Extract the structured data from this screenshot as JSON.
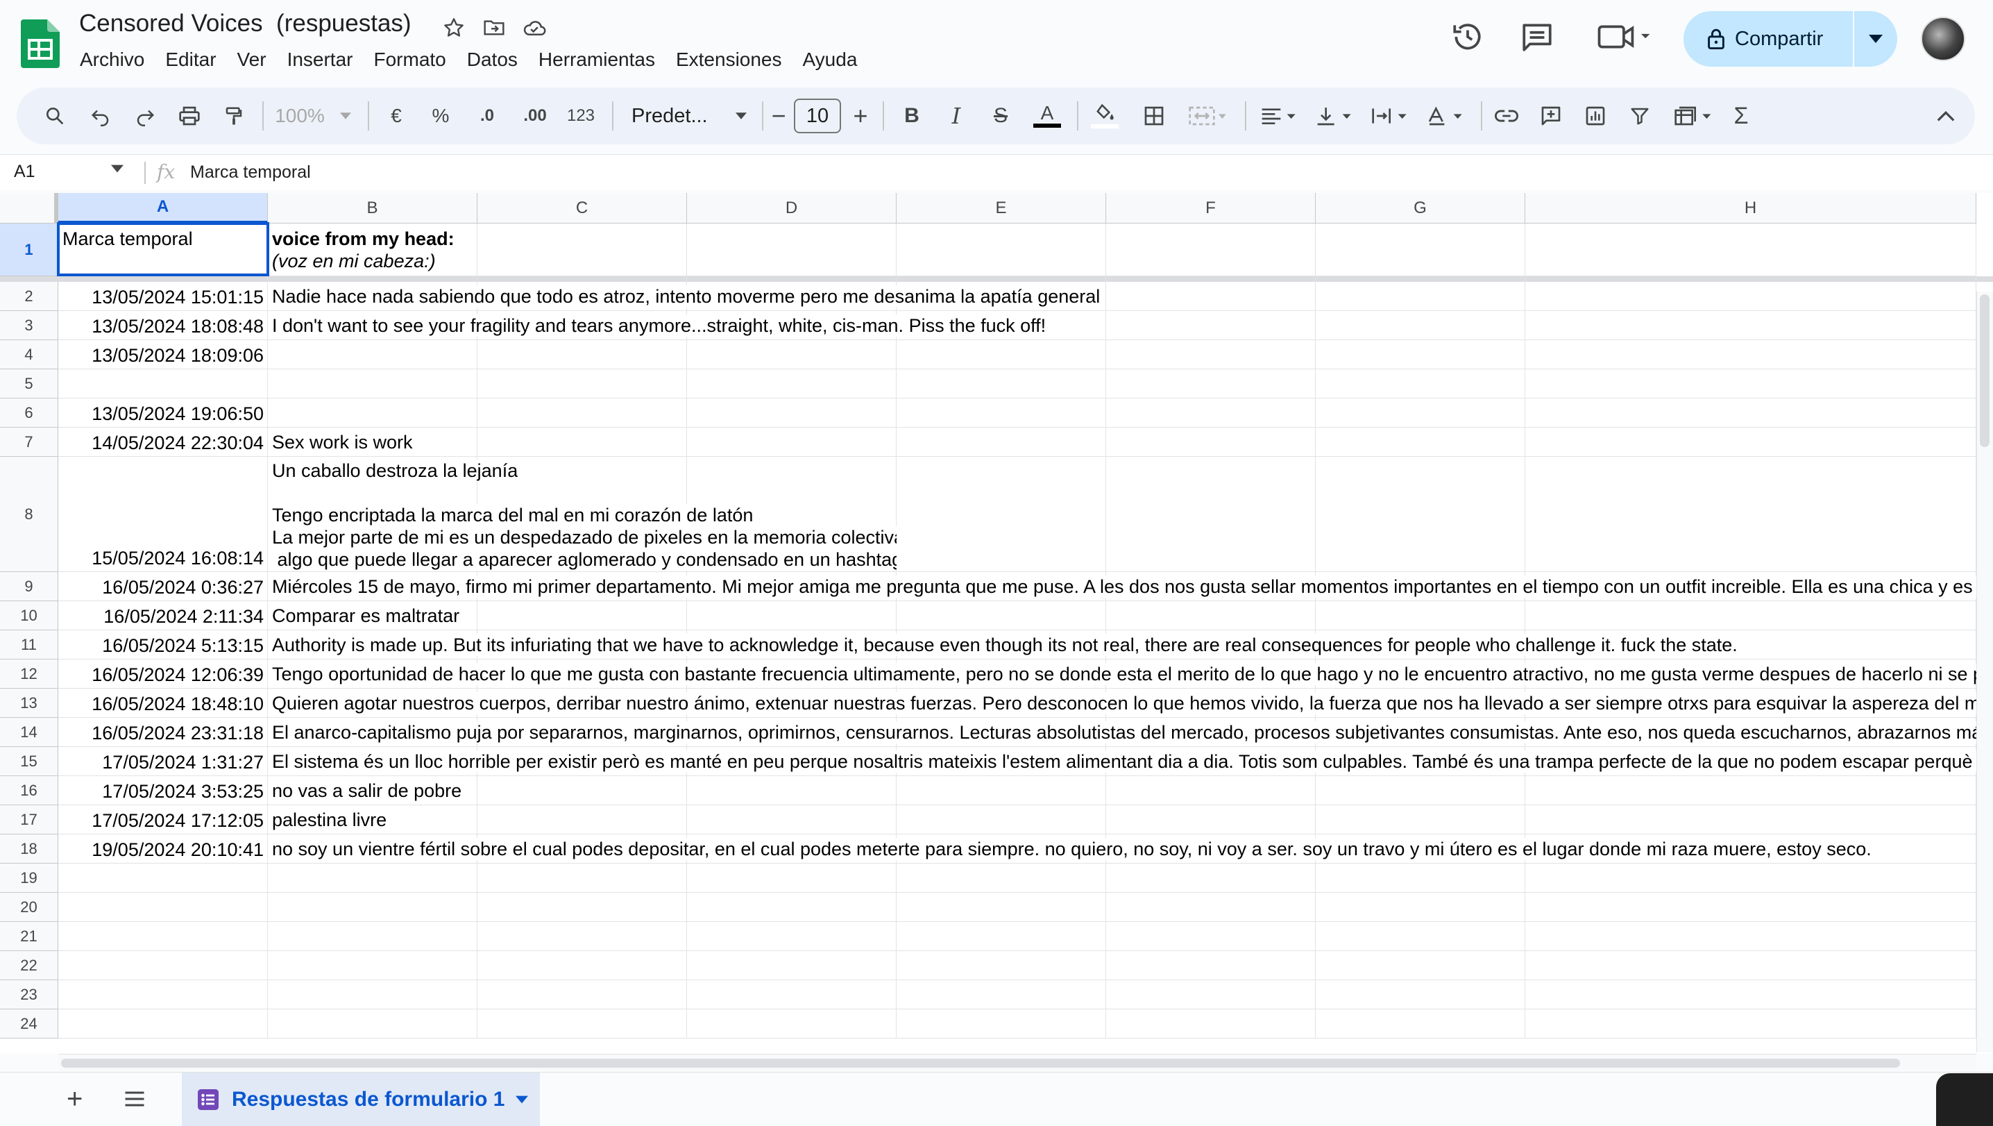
{
  "app": {
    "doc_title": "Censored Voices  (respuestas)",
    "menus": [
      "Archivo",
      "Editar",
      "Ver",
      "Insertar",
      "Formato",
      "Datos",
      "Herramientas",
      "Extensiones",
      "Ayuda"
    ],
    "share_label": "Compartir"
  },
  "toolbar": {
    "zoom": "100%",
    "currency": "€",
    "percent": "%",
    "decrease_decimals": ".0",
    "increase_decimals": ".00",
    "number_format": "123",
    "font_family": "Predet...",
    "font_size": "10"
  },
  "formula_bar": {
    "cell_ref": "A1",
    "fx": "fx",
    "content": "Marca temporal"
  },
  "columns": [
    "A",
    "B",
    "C",
    "D",
    "E",
    "F",
    "G",
    "H"
  ],
  "header_row": {
    "a": "Marca temporal",
    "b_bold": "voice from my head:",
    "b_italic": "(voz en mi cabeza:)"
  },
  "rows": [
    {
      "n": "1"
    },
    {
      "n": "2",
      "ts": "13/05/2024 15:01:15",
      "text": "Nadie hace nada sabiendo que todo es atroz, intento moverme pero me desanima la apatía general"
    },
    {
      "n": "3",
      "ts": "13/05/2024 18:08:48",
      "text": "I don't want to see your fragility and tears anymore...straight, white, cis-man. Piss the fuck off!"
    },
    {
      "n": "4",
      "ts": "13/05/2024 18:09:06",
      "text": ""
    },
    {
      "n": "5",
      "ts": "",
      "text": ""
    },
    {
      "n": "6",
      "ts": "13/05/2024 19:06:50",
      "text": ""
    },
    {
      "n": "7",
      "ts": "14/05/2024 22:30:04",
      "text": "Sex work is work"
    },
    {
      "n": "8",
      "ts": "15/05/2024 16:08:14",
      "lines": [
        "Un caballo destroza la lejanía",
        "",
        "Tengo encriptada la marca del mal en mi corazón de latón",
        "La mejor parte de mi es un despedazado de pixeles en la memoria colectiva",
        " algo que puede llegar a aparecer aglomerado y condensado en un hashtag"
      ]
    },
    {
      "n": "9",
      "ts": "16/05/2024 0:36:27",
      "text": "Miércoles 15 de mayo, firmo mi primer departamento. Mi mejor amiga me pregunta que me puse. A les dos nos gusta sellar momentos importantes en el tiempo con un outfit increible. Ella es una chica y es bla"
    },
    {
      "n": "10",
      "ts": "16/05/2024 2:11:34",
      "text": "Comparar es maltratar"
    },
    {
      "n": "11",
      "ts": "16/05/2024 5:13:15",
      "text": "Authority is made up. But its infuriating that we have to acknowledge it, because even though its not real, there are real consequences for people who challenge it. fuck the state."
    },
    {
      "n": "12",
      "ts": "16/05/2024 12:06:39",
      "text": "Tengo oportunidad de hacer lo que me gusta con bastante frecuencia ultimamente, pero no se donde esta el merito de lo que hago y no le encuentro atractivo, no me gusta verme despues de hacerlo ni se por"
    },
    {
      "n": "13",
      "ts": "16/05/2024 18:48:10",
      "text": "Quieren agotar nuestros cuerpos, derribar nuestro ánimo, extenuar nuestras fuerzas. Pero desconocen lo que hemos vivido, la fuerza que nos ha llevado a ser siempre otrxs para esquivar la aspereza del mun"
    },
    {
      "n": "14",
      "ts": "16/05/2024 23:31:18",
      "text": "El anarco-capitalismo puja por separarnos, marginarnos, oprimirnos, censurarnos. Lecturas absolutistas del mercado, procesos subjetivantes consumistas. Ante eso, nos queda escucharnos, abrazarnos más,"
    },
    {
      "n": "15",
      "ts": "17/05/2024 1:31:27",
      "text": "El sistema és un lloc horrible per existir però es manté en peu perque nosaltris mateixis l'estem alimentant dia a dia. Totis som culpables. També és una trampa perfecte de la que no podem escapar perquè el"
    },
    {
      "n": "16",
      "ts": "17/05/2024 3:53:25",
      "text": "no vas a salir de pobre"
    },
    {
      "n": "17",
      "ts": "17/05/2024 17:12:05",
      "text": "palestina livre"
    },
    {
      "n": "18",
      "ts": "19/05/2024 20:10:41",
      "text": "no soy un vientre fértil sobre el cual podes depositar, en el cual podes meterte para siempre. no quiero, no soy, ni voy a ser. soy un travo y mi útero es el lugar donde mi raza muere, estoy seco."
    },
    {
      "n": "19"
    },
    {
      "n": "20"
    },
    {
      "n": "21"
    },
    {
      "n": "22"
    },
    {
      "n": "23"
    },
    {
      "n": "24"
    }
  ],
  "sheet_tab": {
    "label": "Respuestas de formulario 1"
  },
  "colors": {
    "accent": "#0b57d0",
    "share_bg": "#c2e7ff",
    "sheets_green": "#0f9d58",
    "tab_icon": "#7248b9"
  }
}
